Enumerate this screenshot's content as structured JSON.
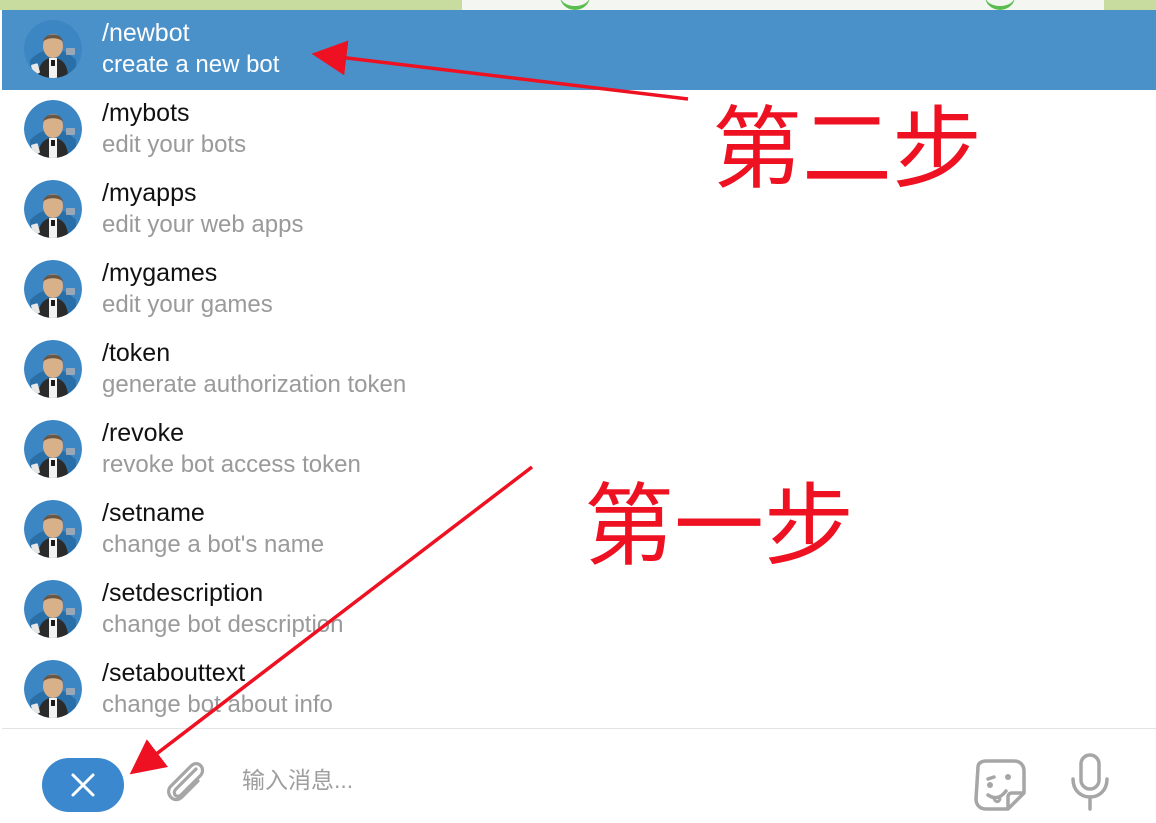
{
  "commands": [
    {
      "name": "/newbot",
      "desc": "create a new bot",
      "active": true
    },
    {
      "name": "/mybots",
      "desc": "edit your bots",
      "active": false
    },
    {
      "name": "/myapps",
      "desc": "edit your web apps",
      "active": false
    },
    {
      "name": "/mygames",
      "desc": "edit your games",
      "active": false
    },
    {
      "name": "/token",
      "desc": "generate authorization token",
      "active": false
    },
    {
      "name": "/revoke",
      "desc": "revoke bot access token",
      "active": false
    },
    {
      "name": "/setname",
      "desc": "change a bot's name",
      "active": false
    },
    {
      "name": "/setdescription",
      "desc": "change bot description",
      "active": false
    },
    {
      "name": "/setabouttext",
      "desc": "change bot about info",
      "active": false
    }
  ],
  "composer": {
    "placeholder": "输入消息...",
    "close_icon": "close-icon",
    "attach_icon": "paperclip-icon",
    "sticker_icon": "sticker-icon",
    "mic_icon": "microphone-icon"
  },
  "annotations": {
    "step_two": "第二步",
    "step_one": "第一步",
    "color": "#ee1122"
  },
  "colors": {
    "active_row": "#4a90c9",
    "close_button": "#3b88cf"
  }
}
